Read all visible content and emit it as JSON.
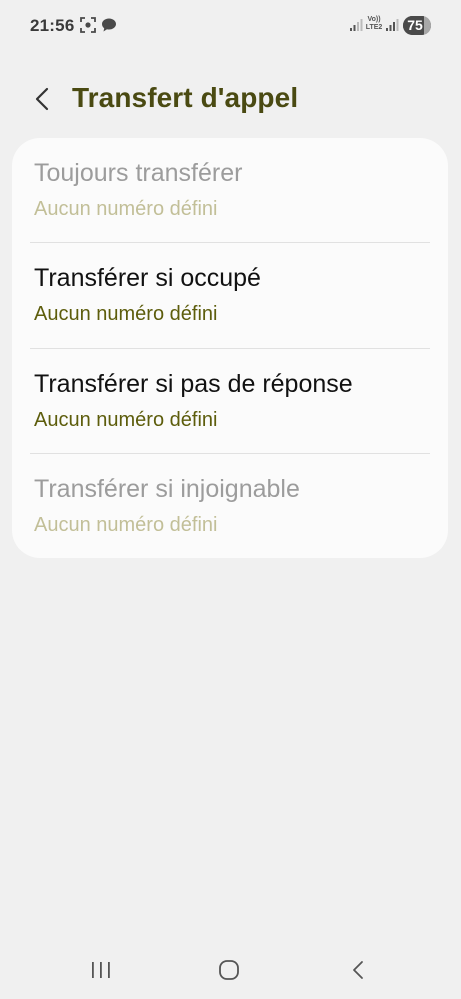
{
  "status_bar": {
    "time": "21:56",
    "volte_line1": "Vo))",
    "volte_line2": "LTE2",
    "battery_level": 75,
    "battery_label": "75",
    "notification_icons": [
      "screenshot-icon",
      "chat-bubble-icon"
    ]
  },
  "header": {
    "title": "Transfert d'appel",
    "back_icon": "chevron-left-icon"
  },
  "settings": {
    "items": [
      {
        "title": "Toujours transférer",
        "subtitle": "Aucun numéro défini",
        "enabled": false
      },
      {
        "title": "Transférer si occupé",
        "subtitle": "Aucun numéro défini",
        "enabled": true
      },
      {
        "title": "Transférer si pas de réponse",
        "subtitle": "Aucun numéro défini",
        "enabled": true
      },
      {
        "title": "Transférer si injoignable",
        "subtitle": "Aucun numéro défini",
        "enabled": false
      }
    ]
  },
  "nav_bar": {
    "icons": [
      "recent-apps-icon",
      "home-icon",
      "back-icon"
    ]
  },
  "colors": {
    "background": "#f0f0f0",
    "card": "#fbfbfb",
    "title": "#4a4a12",
    "subtitle_enabled": "#5d5d0c",
    "subtitle_disabled": "#c2bf98",
    "text_enabled": "#111111",
    "text_disabled": "#9c9c9c"
  }
}
